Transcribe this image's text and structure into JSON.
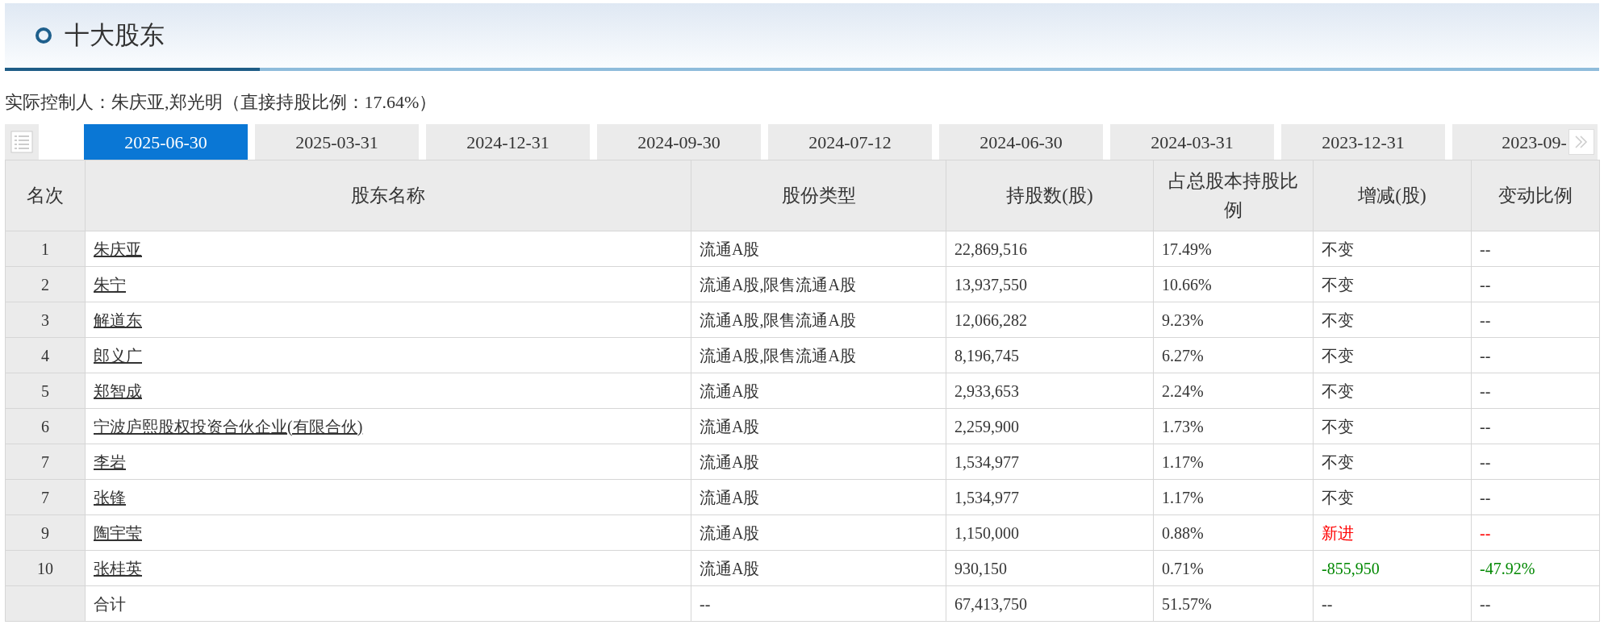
{
  "section": {
    "title": "十大股东"
  },
  "controller": "实际控制人：朱庆亚,郑光明（直接持股比例：17.64%）",
  "tabs": [
    {
      "label": "2025-06-30",
      "selected": true
    },
    {
      "label": "2025-03-31",
      "selected": false
    },
    {
      "label": "2024-12-31",
      "selected": false
    },
    {
      "label": "2024-09-30",
      "selected": false
    },
    {
      "label": "2024-07-12",
      "selected": false
    },
    {
      "label": "2024-06-30",
      "selected": false
    },
    {
      "label": "2024-03-31",
      "selected": false
    },
    {
      "label": "2023-12-31",
      "selected": false
    },
    {
      "label": "2023-09-",
      "selected": false
    }
  ],
  "table": {
    "columns": [
      "名次",
      "股东名称",
      "股份类型",
      "持股数(股)",
      "占总股本持股比例",
      "增减(股)",
      "变动比例"
    ],
    "rows": [
      {
        "rank": "1",
        "name": "朱庆亚",
        "share_type": "流通A股",
        "shares": "22,869,516",
        "ratio": "17.49%",
        "change": "不变",
        "change_ratio": "--",
        "kind": "same"
      },
      {
        "rank": "2",
        "name": "朱宁",
        "share_type": "流通A股,限售流通A股",
        "shares": "13,937,550",
        "ratio": "10.66%",
        "change": "不变",
        "change_ratio": "--",
        "kind": "same"
      },
      {
        "rank": "3",
        "name": "解道东",
        "share_type": "流通A股,限售流通A股",
        "shares": "12,066,282",
        "ratio": "9.23%",
        "change": "不变",
        "change_ratio": "--",
        "kind": "same"
      },
      {
        "rank": "4",
        "name": "郎义广",
        "share_type": "流通A股,限售流通A股",
        "shares": "8,196,745",
        "ratio": "6.27%",
        "change": "不变",
        "change_ratio": "--",
        "kind": "same"
      },
      {
        "rank": "5",
        "name": "郑智成",
        "share_type": "流通A股",
        "shares": "2,933,653",
        "ratio": "2.24%",
        "change": "不变",
        "change_ratio": "--",
        "kind": "same"
      },
      {
        "rank": "6",
        "name": "宁波庐熙股权投资合伙企业(有限合伙)",
        "share_type": "流通A股",
        "shares": "2,259,900",
        "ratio": "1.73%",
        "change": "不变",
        "change_ratio": "--",
        "kind": "same"
      },
      {
        "rank": "7",
        "name": "李岩",
        "share_type": "流通A股",
        "shares": "1,534,977",
        "ratio": "1.17%",
        "change": "不变",
        "change_ratio": "--",
        "kind": "same"
      },
      {
        "rank": "7",
        "name": "张锋",
        "share_type": "流通A股",
        "shares": "1,534,977",
        "ratio": "1.17%",
        "change": "不变",
        "change_ratio": "--",
        "kind": "same"
      },
      {
        "rank": "9",
        "name": "陶宇莹",
        "share_type": "流通A股",
        "shares": "1,150,000",
        "ratio": "0.88%",
        "change": "新进",
        "change_ratio": "--",
        "kind": "new"
      },
      {
        "rank": "10",
        "name": "张桂英",
        "share_type": "流通A股",
        "shares": "930,150",
        "ratio": "0.71%",
        "change": "-855,950",
        "change_ratio": "-47.92%",
        "kind": "decrease"
      }
    ],
    "total": {
      "label": "合计",
      "share_type": "--",
      "shares": "67,413,750",
      "ratio": "51.57%",
      "change": "--",
      "change_ratio": "--"
    }
  }
}
